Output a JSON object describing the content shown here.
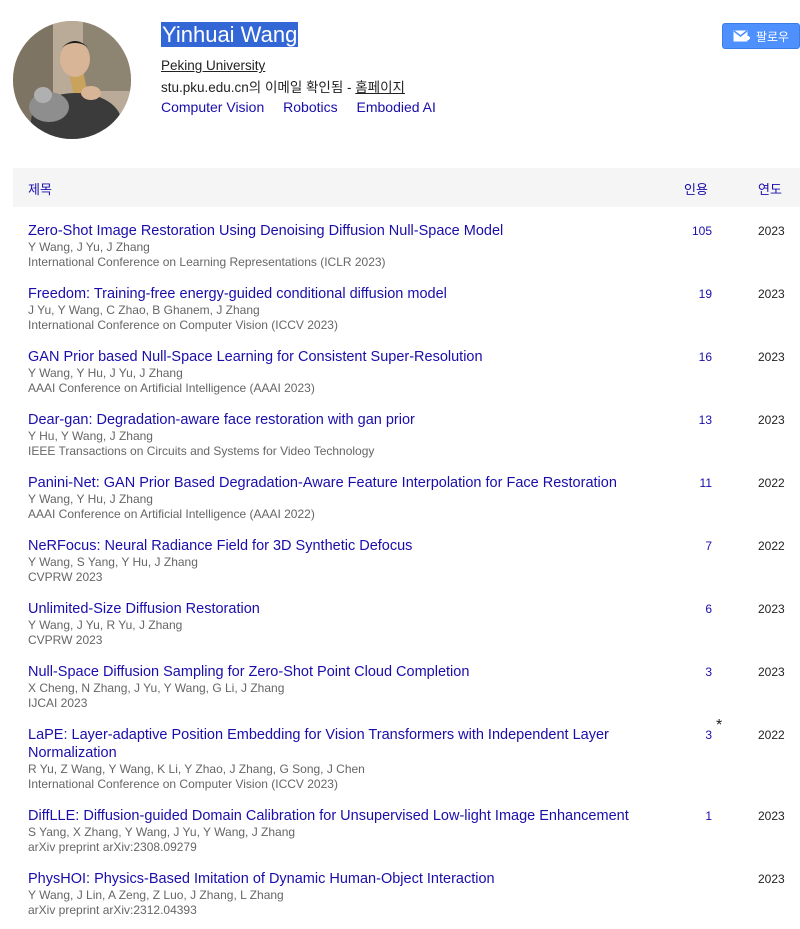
{
  "profile": {
    "name": "Yinhuai Wang",
    "affiliation": "Peking University",
    "email_text": "stu.pku.edu.cn의 이메일 확인됨 - ",
    "homepage_label": "홈페이지",
    "interests": [
      "Computer Vision",
      "Robotics",
      "Embodied AI"
    ],
    "follow_label": "팔로우"
  },
  "colors": {
    "link": "#1a0dab",
    "follow_button": "#4d90fe",
    "name_highlight": "#3367d6"
  },
  "table": {
    "headers": {
      "title": "제목",
      "cited_by": "인용",
      "year": "연도"
    },
    "rows": [
      {
        "title": "Zero-Shot Image Restoration Using Denoising Diffusion Null-Space Model",
        "authors": "Y Wang, J Yu, J Zhang",
        "venue": "International Conference on Learning Representations (ICLR 2023)",
        "cites": "105",
        "star": "",
        "year": "2023"
      },
      {
        "title": "Freedom: Training-free energy-guided conditional diffusion model",
        "authors": "J Yu, Y Wang, C Zhao, B Ghanem, J Zhang",
        "venue": "International Conference on Computer Vision (ICCV 2023)",
        "cites": "19",
        "star": "",
        "year": "2023"
      },
      {
        "title": "GAN Prior based Null-Space Learning for Consistent Super-Resolution",
        "authors": "Y Wang, Y Hu, J Yu, J Zhang",
        "venue": "AAAI Conference on Artificial Intelligence (AAAI 2023)",
        "cites": "16",
        "star": "",
        "year": "2023"
      },
      {
        "title": "Dear-gan: Degradation-aware face restoration with gan prior",
        "authors": "Y Hu, Y Wang, J Zhang",
        "venue": "IEEE Transactions on Circuits and Systems for Video Technology",
        "cites": "13",
        "star": "",
        "year": "2023"
      },
      {
        "title": "Panini-Net: GAN Prior Based Degradation-Aware Feature Interpolation for Face Restoration",
        "authors": "Y Wang, Y Hu, J Zhang",
        "venue": "AAAI Conference on Artificial Intelligence (AAAI 2022)",
        "cites": "11",
        "star": "",
        "year": "2022"
      },
      {
        "title": "NeRFocus: Neural Radiance Field for 3D Synthetic Defocus",
        "authors": "Y Wang, S Yang, Y Hu, J Zhang",
        "venue": "CVPRW 2023",
        "cites": "7",
        "star": "",
        "year": "2022"
      },
      {
        "title": "Unlimited-Size Diffusion Restoration",
        "authors": "Y Wang, J Yu, R Yu, J Zhang",
        "venue": "CVPRW 2023",
        "cites": "6",
        "star": "",
        "year": "2023"
      },
      {
        "title": "Null-Space Diffusion Sampling for Zero-Shot Point Cloud Completion",
        "authors": "X Cheng, N Zhang, J Yu, Y Wang, G Li, J Zhang",
        "venue": "IJCAI 2023",
        "cites": "3",
        "star": "",
        "year": "2023"
      },
      {
        "title": "LaPE: Layer-adaptive Position Embedding for Vision Transformers with Independent Layer Normalization",
        "authors": "R Yu, Z Wang, Y Wang, K Li, Y Zhao, J Zhang, G Song, J Chen",
        "venue": "International Conference on Computer Vision (ICCV 2023)",
        "cites": "3",
        "star": "*",
        "year": "2022"
      },
      {
        "title": "DiffLLE: Diffusion-guided Domain Calibration for Unsupervised Low-light Image Enhancement",
        "authors": "S Yang, X Zhang, Y Wang, J Yu, Y Wang, J Zhang",
        "venue": "arXiv preprint arXiv:2308.09279",
        "cites": "1",
        "star": "",
        "year": "2023"
      },
      {
        "title": "PhysHOI: Physics-Based Imitation of Dynamic Human-Object Interaction",
        "authors": "Y Wang, J Lin, A Zeng, Z Luo, J Zhang, L Zhang",
        "venue": "arXiv preprint arXiv:2312.04393",
        "cites": "",
        "star": "",
        "year": "2023"
      }
    ]
  }
}
